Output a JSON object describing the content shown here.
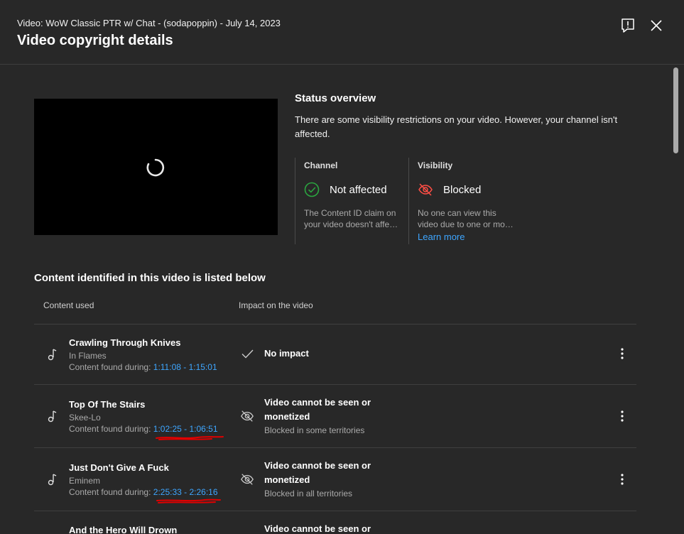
{
  "header": {
    "subtitle": "Video: WoW Classic PTR w/ Chat - (sodapoppin) - July 14, 2023",
    "title": "Video copyright details",
    "feedback_icon": "feedback-icon",
    "close_icon": "close-icon"
  },
  "status": {
    "title": "Status overview",
    "description": "There are some visibility restrictions on your video. However, your channel isn't affected.",
    "channel": {
      "label": "Channel",
      "state": "Not affected",
      "desc_line1": "The Content ID claim on",
      "desc_line2": "your video doesn't affect your channel",
      "icon": "check-circle-icon",
      "color": "#2ba640"
    },
    "visibility": {
      "label": "Visibility",
      "state": "Blocked",
      "desc_line1": "No one can view this",
      "desc_line2": "video due to one or more claims",
      "learn_more": "Learn more",
      "icon": "eye-off-icon",
      "color": "#ff4e45"
    }
  },
  "content": {
    "title": "Content identified in this video is listed below",
    "col_content": "Content used",
    "col_impact": "Impact on the video",
    "found_label": "Content found during:",
    "rows": [
      {
        "title": "Crawling Through Knives",
        "artist": "In Flames",
        "time": "1:11:08 - 1:15:01",
        "impact": "No impact",
        "impact_sub": "",
        "impact_icon": "checkmark-icon"
      },
      {
        "title": "Top Of The Stairs",
        "artist": "Skee-Lo",
        "time": "1:02:25 - 1:06:51",
        "impact": "Video cannot be seen or monetized",
        "impact_sub": "Blocked in some territories",
        "impact_icon": "eye-off-icon"
      },
      {
        "title": "Just Don't Give A Fuck",
        "artist": "Eminem",
        "time": "2:25:33 - 2:26:16",
        "impact": "Video cannot be seen or monetized",
        "impact_sub": "Blocked in all territories",
        "impact_icon": "eye-off-icon"
      },
      {
        "title": "And the Hero Will Drown",
        "artist": "",
        "time": "",
        "impact": "Video cannot be seen or",
        "impact_sub": "",
        "impact_icon": ""
      }
    ]
  },
  "colors": {
    "background": "#282828",
    "accent_link": "#3ea6ff",
    "annotation": "#e00000"
  }
}
